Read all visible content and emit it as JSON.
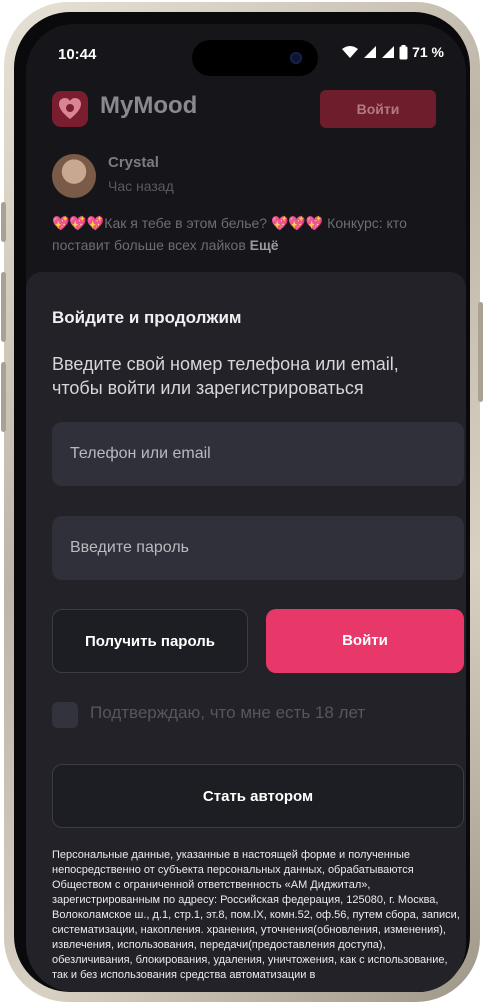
{
  "status_bar": {
    "time": "10:44",
    "battery": "71 %"
  },
  "header": {
    "app_name": "MyMood",
    "login_button": "Войти",
    "logo_color": "#7a1e2f"
  },
  "post": {
    "author": "Crystal",
    "time_ago": "Час назад",
    "hearts": "💖💖💖",
    "text_1": "Как я тебе в этом белье? ",
    "text_2": " Конкурс: кто поставит больше всех лайков",
    "more": "Ещё"
  },
  "login_sheet": {
    "title": "Войдите и продолжим",
    "subtitle": "Введите свой номер телефона или email, чтобы войти или зарегистрироваться",
    "phone_placeholder": "Телефон или email",
    "password_placeholder": "Введите пароль",
    "get_password_button": "Получить пароль",
    "login_button": "Войти",
    "age_checkbox_label": "Подтверждаю, что мне есть 18 лет",
    "become_author_button": "Стать автором",
    "legal_text": "Персональные данные, указанные в настоящей форме и полученные непосредственно от субъекта персональных данных, обрабатываются Обществом с ограниченной ответственность «АМ Диджитал», зарегистрированным по адресу: Российская федерация, 125080, г. Москва, Волоколамское ш., д.1, стр.1, эт.8, пом.IX, комн.52, оф.56, путем сбора, записи, систематизации, накопления. хранения, уточнения(обновления, изменения), извлечения, использования, передачи(предоставления доступа), обезличивания, блокирования, удаления, уничтожения, как с использование, так и без использования средства автоматизации в"
  },
  "colors": {
    "accent": "#e8386a",
    "sheet_bg": "#222228",
    "field_bg": "#30303a"
  }
}
